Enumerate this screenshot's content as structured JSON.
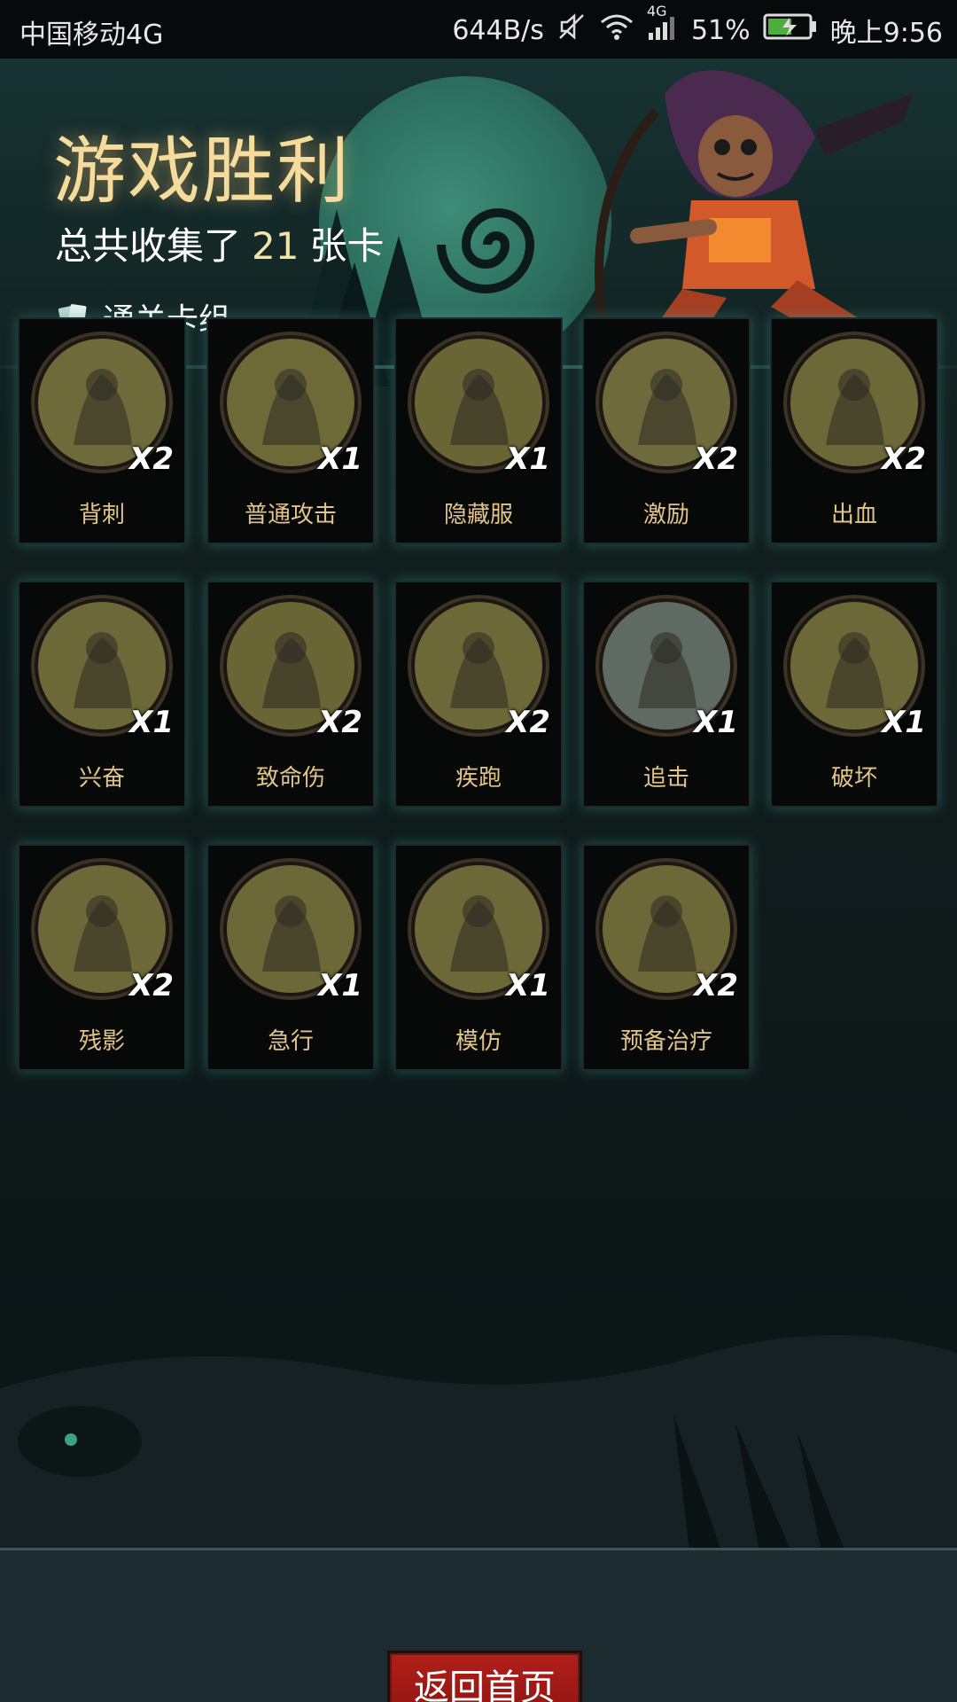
{
  "status_bar": {
    "carrier": "中国移动4G",
    "net_speed": "644B/s",
    "network": "4G",
    "battery": "51%",
    "time": "晚上9:56",
    "icons": [
      "mute-icon",
      "wifi-icon",
      "signal-icon",
      "battery-icon"
    ]
  },
  "header": {
    "title": "游戏胜利",
    "summary_prefix": "总共收集了",
    "summary_count": "21",
    "summary_suffix": "张卡",
    "deck_link": "通关卡组"
  },
  "cards": [
    {
      "name": "背刺",
      "count": "X2",
      "icon": "backstab-icon",
      "color": "#6f6a3a"
    },
    {
      "name": "普通攻击",
      "count": "X1",
      "icon": "spear-icon",
      "color": "#6d6a38"
    },
    {
      "name": "隐藏服",
      "count": "X1",
      "icon": "hood-icon",
      "color": "#6a6535"
    },
    {
      "name": "激励",
      "count": "X2",
      "icon": "hammer-icon",
      "color": "#6f6a3c"
    },
    {
      "name": "出血",
      "count": "X2",
      "icon": "tentacle-icon",
      "color": "#6d6838"
    },
    {
      "name": "兴奋",
      "count": "X1",
      "icon": "excited-icon",
      "color": "#6d6838"
    },
    {
      "name": "致命伤",
      "count": "X2",
      "icon": "dagger-icon",
      "color": "#6a6535"
    },
    {
      "name": "疾跑",
      "count": "X2",
      "icon": "sprint-icon",
      "color": "#6d6838"
    },
    {
      "name": "追击",
      "count": "X1",
      "icon": "chase-icon",
      "color": "#5f6a62"
    },
    {
      "name": "破坏",
      "count": "X1",
      "icon": "break-icon",
      "color": "#6d6838"
    },
    {
      "name": "残影",
      "count": "X2",
      "icon": "afterimage-icon",
      "color": "#6d6838"
    },
    {
      "name": "急行",
      "count": "X1",
      "icon": "dash-icon",
      "color": "#6d6838"
    },
    {
      "name": "模仿",
      "count": "X1",
      "icon": "mimic-icon",
      "color": "#6d6838"
    },
    {
      "name": "预备治疗",
      "count": "X2",
      "icon": "heart-heal-icon",
      "color": "#6d6838"
    }
  ],
  "return_button": "返回首页",
  "colors": {
    "card_label": "#e3c48a",
    "title": "#f6dc9c",
    "button": "#b21f1a",
    "card_glow": "#3ca096"
  }
}
